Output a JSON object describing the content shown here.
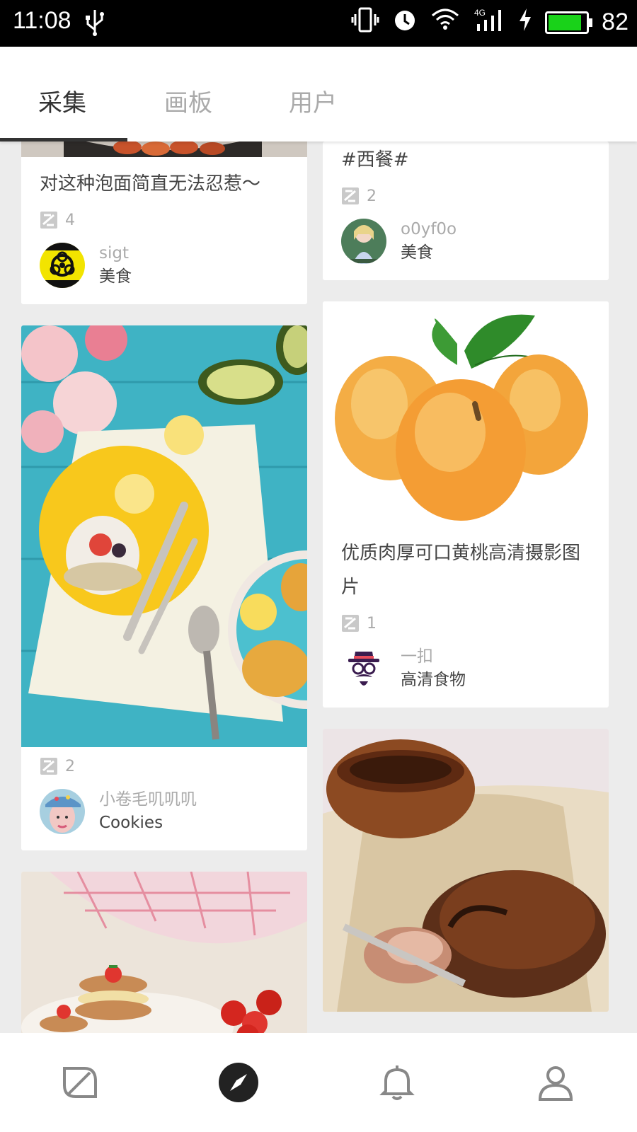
{
  "status_bar": {
    "time": "11:08",
    "battery_percent": "82",
    "battery_level": 0.82,
    "icons": [
      "usb-icon",
      "vibrate-icon",
      "alarm-icon",
      "wifi-icon",
      "signal-4g-icon",
      "charging-icon",
      "battery-icon"
    ]
  },
  "tabs": [
    {
      "label": "采集",
      "active": true
    },
    {
      "label": "画板",
      "active": false
    },
    {
      "label": "用户",
      "active": false
    }
  ],
  "feed": {
    "left": [
      {
        "title": "对这种泡面简直无法忍惹～",
        "count": "4",
        "user": "sigt",
        "board": "美食"
      },
      {
        "title": "",
        "count": "2",
        "user": "小卷毛叽叽叽",
        "board": "Cookies"
      }
    ],
    "right": [
      {
        "title": "#西餐#",
        "count": "2",
        "user": "o0yf0o",
        "board": "美食"
      },
      {
        "title": "优质肉厚可口黄桃高清摄影图片",
        "count": "1",
        "user": "一扣",
        "board": "高清食物"
      }
    ]
  },
  "nav": [
    {
      "icon": "leaf-icon"
    },
    {
      "icon": "compass-icon",
      "active": true
    },
    {
      "icon": "bell-icon"
    },
    {
      "icon": "profile-icon"
    }
  ],
  "colors": {
    "accent": "#333333",
    "muted": "#aaaaaa",
    "background": "#ececec",
    "battery": "#19d219"
  }
}
